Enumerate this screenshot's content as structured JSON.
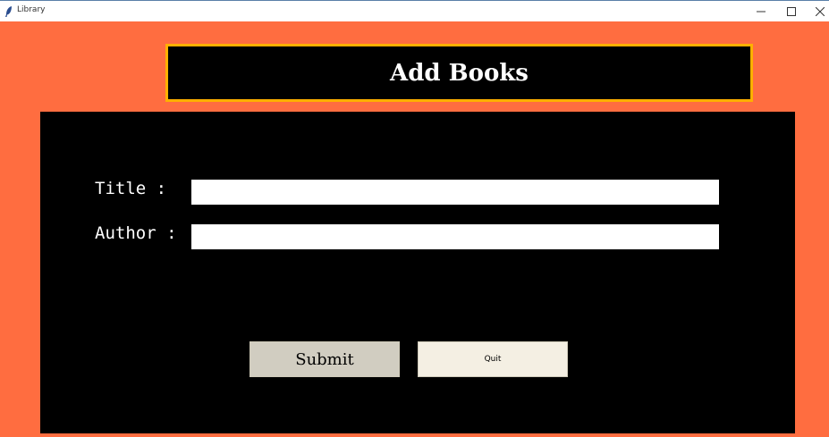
{
  "window": {
    "title": "Library",
    "icon": "feather-icon",
    "controls": [
      "minimize-icon",
      "maximize-icon",
      "close-icon"
    ]
  },
  "header": {
    "title": "Add Books"
  },
  "form": {
    "title_label": "Title :",
    "title_value": "",
    "author_label": "Author :",
    "author_value": ""
  },
  "buttons": {
    "submit_label": "Submit",
    "quit_label": "Quit"
  },
  "colors": {
    "background": "#ff6d40",
    "panel": "#000000",
    "header_border": "#ffb000",
    "submit_bg": "#d1cdc1",
    "quit_bg": "#f4efe3"
  }
}
